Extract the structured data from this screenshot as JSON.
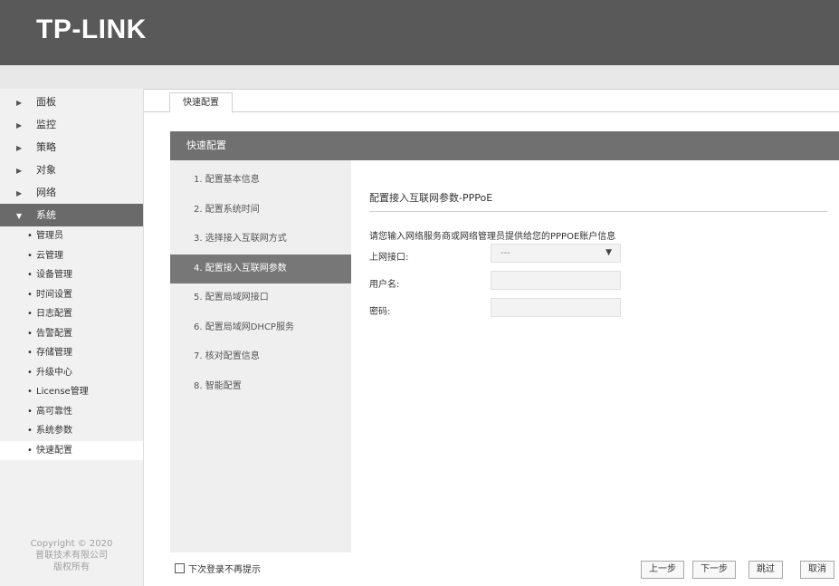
{
  "header": {
    "logo": "TP-LINK"
  },
  "sidebar": {
    "items": [
      {
        "label": "面板"
      },
      {
        "label": "监控"
      },
      {
        "label": "策略"
      },
      {
        "label": "对象"
      },
      {
        "label": "网络"
      },
      {
        "label": "系统"
      }
    ],
    "subitems": [
      "管理员",
      "云管理",
      "设备管理",
      "时间设置",
      "日志配置",
      "告警配置",
      "存储管理",
      "升级中心",
      "License管理",
      "高可靠性",
      "系统参数",
      "快速配置"
    ],
    "copyright": [
      "Copyright © 2020",
      "普联技术有限公司",
      "版权所有"
    ]
  },
  "tab": {
    "label": "快速配置"
  },
  "panel": {
    "title": "快速配置",
    "steps": [
      "1. 配置基本信息",
      "2. 配置系统时间",
      "3. 选择接入互联网方式",
      "4. 配置接入互联网参数",
      "5. 配置局域网接口",
      "6. 配置局域网DHCP服务",
      "7. 核对配置信息",
      "8. 智能配置"
    ]
  },
  "form": {
    "title": "配置接入互联网参数-PPPoE",
    "description": "请您输入网络服务商或网络管理员提供给您的PPPOE账户信息",
    "interface_label": "上网接口:",
    "interface_value": "---",
    "username_label": "用户名:",
    "password_label": "密码:"
  },
  "footer": {
    "checkbox_label": "下次登录不再提示",
    "prev": "上一步",
    "next": "下一步",
    "skip": "跳过",
    "cancel": "取消"
  }
}
